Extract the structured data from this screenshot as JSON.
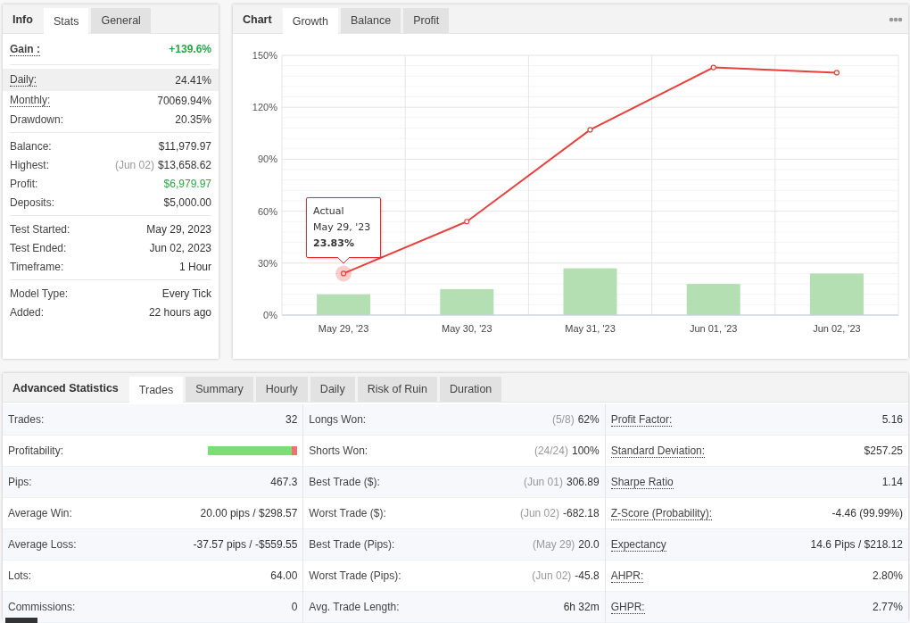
{
  "stats_panel": {
    "title": "Info",
    "tabs": [
      {
        "label": "Stats",
        "selected": true
      },
      {
        "label": "General",
        "selected": false
      }
    ],
    "groups": [
      {
        "rows": [
          {
            "label": "Gain :",
            "value": "+139.6%",
            "underlined": true,
            "highlighted": false,
            "emphasis": true,
            "positive": true
          }
        ]
      },
      {
        "rows": [
          {
            "label": "Daily:",
            "value": "24.41%",
            "underlined": true,
            "highlighted": true,
            "emphasis": false,
            "positive": false
          },
          {
            "label": "Monthly:",
            "value": "70069.94%",
            "underlined": true,
            "highlighted": false,
            "emphasis": false,
            "positive": false
          },
          {
            "label": "Drawdown:",
            "value": "20.35%",
            "underlined": false,
            "highlighted": false,
            "emphasis": false,
            "positive": false
          }
        ]
      },
      {
        "rows": [
          {
            "label": "Balance:",
            "value": "$11,979.97",
            "underlined": false,
            "highlighted": false,
            "emphasis": false,
            "positive": false
          },
          {
            "label": "Highest:",
            "note": "(Jun 02)",
            "value": "$13,658.62",
            "underlined": false,
            "highlighted": false,
            "emphasis": false,
            "positive": false
          },
          {
            "label": "Profit:",
            "value": "$6,979.97",
            "underlined": false,
            "highlighted": false,
            "emphasis": false,
            "positive": true
          },
          {
            "label": "Deposits:",
            "value": "$5,000.00",
            "underlined": false,
            "highlighted": false,
            "emphasis": false,
            "positive": false
          }
        ]
      },
      {
        "rows": [
          {
            "label": "Test Started:",
            "value": "May 29, 2023",
            "underlined": false,
            "highlighted": false,
            "emphasis": false,
            "positive": false
          },
          {
            "label": "Test Ended:",
            "value": "Jun 02, 2023",
            "underlined": false,
            "highlighted": false,
            "emphasis": false,
            "positive": false
          },
          {
            "label": "Timeframe:",
            "value": "1 Hour",
            "underlined": false,
            "highlighted": false,
            "emphasis": false,
            "positive": false
          }
        ]
      },
      {
        "rows": [
          {
            "label": "Model Type:",
            "value": "Every Tick",
            "underlined": false,
            "highlighted": false,
            "emphasis": false,
            "positive": false
          },
          {
            "label": "Added:",
            "value": "22 hours ago",
            "underlined": false,
            "highlighted": false,
            "emphasis": false,
            "positive": false
          }
        ]
      }
    ]
  },
  "chart_panel": {
    "title": "Chart",
    "tabs": [
      {
        "label": "Growth",
        "selected": true
      },
      {
        "label": "Balance",
        "selected": false
      },
      {
        "label": "Profit",
        "selected": false
      }
    ],
    "tooltip": {
      "date": "May 29, '23",
      "value": "23.83%"
    },
    "chart_data": {
      "type": "line",
      "categories": [
        "May 29, '23",
        "May 30, '23",
        "May 31, '23",
        "Jun 01, '23",
        "Jun 02, '23"
      ],
      "series": [
        {
          "type": "bar",
          "color": "#b3dfb3",
          "values": [
            12,
            15,
            27,
            18,
            24
          ]
        },
        {
          "name": "Actual",
          "type": "line",
          "color": "#e8403c",
          "marker": true,
          "values": [
            24,
            54,
            107,
            143,
            140
          ]
        }
      ],
      "grid": true,
      "ylim": [
        0,
        150
      ],
      "yticks": [
        {
          "value": 0,
          "label": "0%"
        },
        {
          "value": 30,
          "label": "30%"
        },
        {
          "value": 60,
          "label": "60%"
        },
        {
          "value": 90,
          "label": "90%"
        },
        {
          "value": 120,
          "label": "120%"
        },
        {
          "value": 150,
          "label": "150%"
        }
      ]
    }
  },
  "advanced_panel": {
    "title": "Advanced Statistics",
    "tabs": [
      {
        "label": "Trades",
        "selected": true
      },
      {
        "label": "Summary",
        "selected": false
      },
      {
        "label": "Hourly",
        "selected": false
      },
      {
        "label": "Daily",
        "selected": false
      },
      {
        "label": "Risk of Ruin",
        "selected": false
      },
      {
        "label": "Duration",
        "selected": false
      }
    ],
    "columns": [
      [
        {
          "kind": "text",
          "label": "Trades:",
          "value": "32",
          "underlined": false
        },
        {
          "kind": "bar",
          "label": "Profitability:",
          "level": 0.94,
          "underlined": false
        },
        {
          "kind": "text",
          "label": "Pips:",
          "value": "467.3",
          "underlined": false
        },
        {
          "kind": "text",
          "label": "Average Win:",
          "value": "20.00 pips / $298.57",
          "underlined": false
        },
        {
          "kind": "text",
          "label": "Average Loss:",
          "value": "-37.57 pips / -$559.55",
          "underlined": false
        },
        {
          "kind": "text",
          "label": "Lots:",
          "value": "64.00",
          "underlined": false
        },
        {
          "kind": "text",
          "label": "Commissions:",
          "value": "0",
          "underlined": false
        }
      ],
      [
        {
          "kind": "text",
          "label": "Longs Won:",
          "note": "(5/8)",
          "value": "62%",
          "underlined": false
        },
        {
          "kind": "text",
          "label": "Shorts Won:",
          "note": "(24/24)",
          "value": "100%",
          "underlined": false
        },
        {
          "kind": "text",
          "label": "Best Trade ($):",
          "note": "(Jun 01)",
          "value": "306.89",
          "underlined": false
        },
        {
          "kind": "text",
          "label": "Worst Trade ($):",
          "note": "(Jun 02)",
          "value": "-682.18",
          "underlined": false
        },
        {
          "kind": "text",
          "label": "Best Trade (Pips):",
          "note": "(May 29)",
          "value": "20.0",
          "underlined": false
        },
        {
          "kind": "text",
          "label": "Worst Trade (Pips):",
          "note": "(Jun 02)",
          "value": "-45.8",
          "underlined": false
        },
        {
          "kind": "text",
          "label": "Avg. Trade Length:",
          "value": "6h 32m",
          "underlined": false
        }
      ],
      [
        {
          "kind": "text",
          "label": "Profit Factor:",
          "value": "5.16",
          "underlined": true
        },
        {
          "kind": "text",
          "label": "Standard Deviation:",
          "value": "$257.25",
          "underlined": true
        },
        {
          "kind": "text",
          "label": "Sharpe Ratio",
          "value": "1.14",
          "underlined": true
        },
        {
          "kind": "text",
          "label": "Z-Score (Probability):",
          "value": "-4.46 (99.99%)",
          "underlined": true
        },
        {
          "kind": "text",
          "label": "Expectancy",
          "value": "14.6 Pips / $218.12",
          "underlined": true
        },
        {
          "kind": "text",
          "label": "AHPR:",
          "value": "2.80%",
          "underlined": true
        },
        {
          "kind": "text",
          "label": "GHPR:",
          "value": "2.77%",
          "underlined": true
        }
      ]
    ]
  }
}
